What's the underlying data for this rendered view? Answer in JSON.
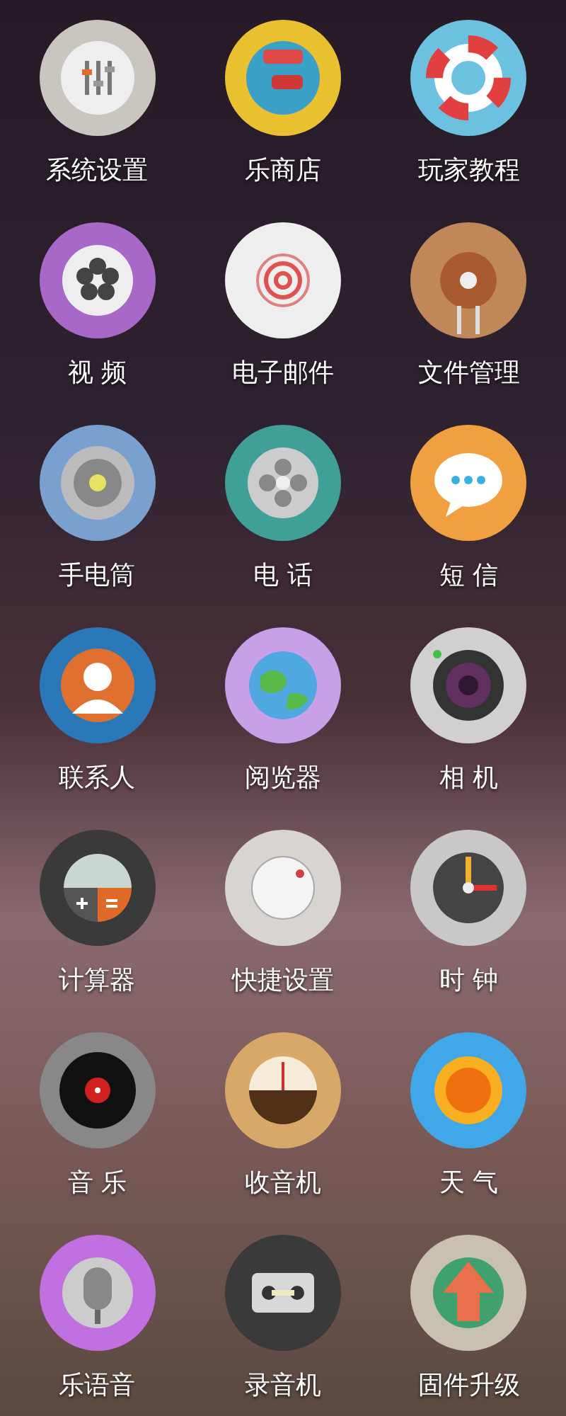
{
  "apps": [
    {
      "label": "系统设置"
    },
    {
      "label": "乐商店"
    },
    {
      "label": "玩家教程"
    },
    {
      "label": "视 频"
    },
    {
      "label": "电子邮件"
    },
    {
      "label": "文件管理"
    },
    {
      "label": "手电筒"
    },
    {
      "label": "电 话"
    },
    {
      "label": "短 信"
    },
    {
      "label": "联系人"
    },
    {
      "label": "阅览器"
    },
    {
      "label": "相 机"
    },
    {
      "label": "计算器"
    },
    {
      "label": "快捷设置"
    },
    {
      "label": "时 钟"
    },
    {
      "label": "音 乐"
    },
    {
      "label": "收音机"
    },
    {
      "label": "天 气"
    },
    {
      "label": "乐语音"
    },
    {
      "label": "录音机"
    },
    {
      "label": "固件升级"
    }
  ]
}
